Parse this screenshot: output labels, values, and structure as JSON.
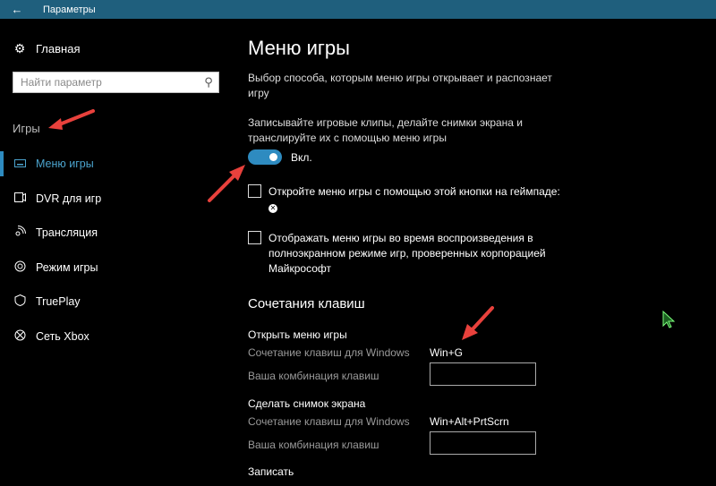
{
  "window": {
    "title": "Параметры"
  },
  "sidebar": {
    "home_label": "Главная",
    "search_placeholder": "Найти параметр",
    "section_title": "Игры",
    "items": [
      {
        "label": "Меню игры",
        "icon": "keyboard-icon",
        "active": true
      },
      {
        "label": "DVR для игр",
        "icon": "dvr-icon",
        "active": false
      },
      {
        "label": "Трансляция",
        "icon": "broadcast-icon",
        "active": false
      },
      {
        "label": "Режим игры",
        "icon": "gamemode-icon",
        "active": false
      },
      {
        "label": "TruePlay",
        "icon": "shield-icon",
        "active": false
      },
      {
        "label": "Сеть Xbox",
        "icon": "xbox-icon",
        "active": false
      }
    ]
  },
  "main": {
    "title": "Меню игры",
    "description": "Выбор способа, которым меню игры открывает и распознает игру",
    "record_description": "Записывайте игровые клипы, делайте снимки экрана и транслируйте их с помощью меню игры",
    "toggle_label": "Вкл.",
    "toggle_on": true,
    "checkbox_gamepad": "Откройте меню игры с помощью этой кнопки на геймпаде:",
    "checkbox_fullscreen": "Отображать меню игры во время воспроизведения в полноэкранном режиме игр, проверенных корпорацией Майкрософт",
    "shortcuts_title": "Сочетания клавиш",
    "shortcuts": [
      {
        "title": "Открыть меню игры",
        "windows_label": "Сочетание клавиш для Windows",
        "windows_value": "Win+G",
        "custom_label": "Ваша комбинация клавиш"
      },
      {
        "title": "Сделать снимок экрана",
        "windows_label": "Сочетание клавиш для Windows",
        "windows_value": "Win+Alt+PrtScrn",
        "custom_label": "Ваша комбинация клавиш"
      }
    ],
    "record_title": "Записать"
  },
  "colors": {
    "accent": "#2e8bc0",
    "titlebar": "#1f5f7d",
    "arrow": "#e8413c"
  }
}
